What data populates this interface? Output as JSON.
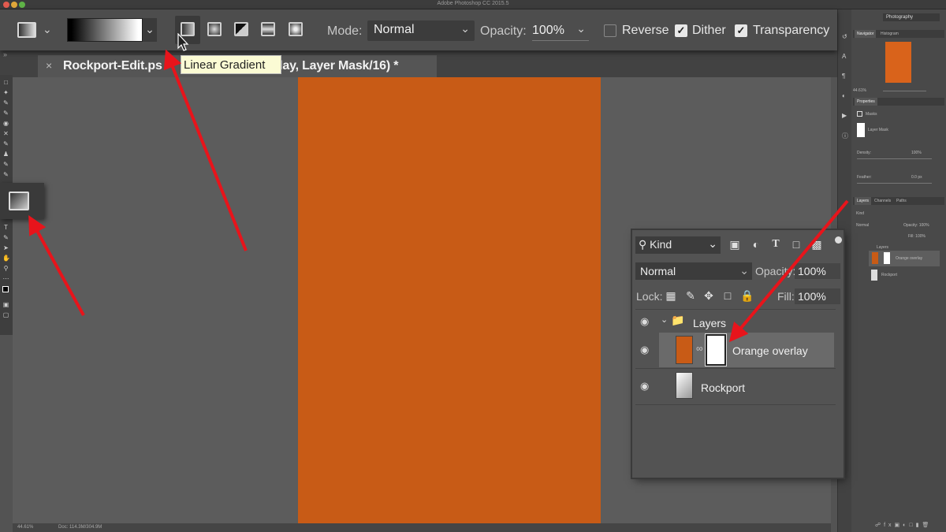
{
  "app": {
    "title": "Adobe Photoshop CC 2015.5",
    "workspace": "Photography"
  },
  "colors": {
    "accent_orange": "#c85b16",
    "arrow_red": "#e8141b",
    "tooltip_bg": "#fbfbd4"
  },
  "options_bar": {
    "tool_preset_icon": "gradient-tool-preset-icon",
    "gradient_picker": "black-to-white",
    "gradient_types": [
      {
        "name": "Linear Gradient",
        "icon": "linear-gradient-icon",
        "selected": true
      },
      {
        "name": "Radial Gradient",
        "icon": "radial-gradient-icon",
        "selected": false
      },
      {
        "name": "Angle Gradient",
        "icon": "angle-gradient-icon",
        "selected": false
      },
      {
        "name": "Reflected Gradient",
        "icon": "reflected-gradient-icon",
        "selected": false
      },
      {
        "name": "Diamond Gradient",
        "icon": "diamond-gradient-icon",
        "selected": false
      }
    ],
    "mode_label": "Mode:",
    "mode_value": "Normal",
    "opacity_label": "Opacity:",
    "opacity_value": "100%",
    "reverse_label": "Reverse",
    "reverse_checked": false,
    "dither_label": "Dither",
    "dither_checked": true,
    "transparency_label": "Transparency",
    "transparency_checked": true,
    "tooltip": "Linear Gradient"
  },
  "document": {
    "tab_close": "×",
    "tab_title": "Rockport-Edit.psd @ 44.6% (Orange overlay, Layer Mask/16) *",
    "tab_title_visible_left": "Rockport-Edit.ps",
    "tab_title_visible_right": "verlay, Layer Mask/16) *",
    "zoom": "44.61%",
    "doc_info": "Doc: 114.3M/304.9M"
  },
  "right_panels": {
    "navigator_tabs": [
      "Navigator",
      "Histogram"
    ],
    "navigator_zoom": "44.61%",
    "properties_title": "Properties",
    "properties_section": "Masks",
    "mask_type": "Layer Mask",
    "density_label": "Density:",
    "density_value": "100%",
    "feather_label": "Feather:",
    "feather_value": "0.0 px",
    "layers_tabs": [
      "Layers",
      "Channels",
      "Paths"
    ],
    "mini_kind": "Kind",
    "mini_blend": "Normal",
    "mini_opacity": "Opacity: 100%",
    "mini_fill": "Fill: 100%",
    "mini_layers": [
      "Layers",
      "Orange overlay",
      "Rockport"
    ]
  },
  "layers_panel": {
    "filter_kind": "Kind",
    "filter_icons": [
      "pixel-layer-filter-icon",
      "adjustment-filter-icon",
      "type-filter-icon",
      "shape-filter-icon",
      "smart-object-filter-icon"
    ],
    "blend_mode": "Normal",
    "opacity_label": "Opacity:",
    "opacity_value": "100%",
    "lock_label": "Lock:",
    "fill_label": "Fill:",
    "fill_value": "100%",
    "layers": [
      {
        "name": "Layers",
        "type": "group",
        "visible": true,
        "expanded": true
      },
      {
        "name": "Orange overlay",
        "type": "fill-with-mask",
        "visible": true,
        "selected": true
      },
      {
        "name": "Rockport",
        "type": "smart-object",
        "visible": true,
        "selected": false
      }
    ]
  }
}
